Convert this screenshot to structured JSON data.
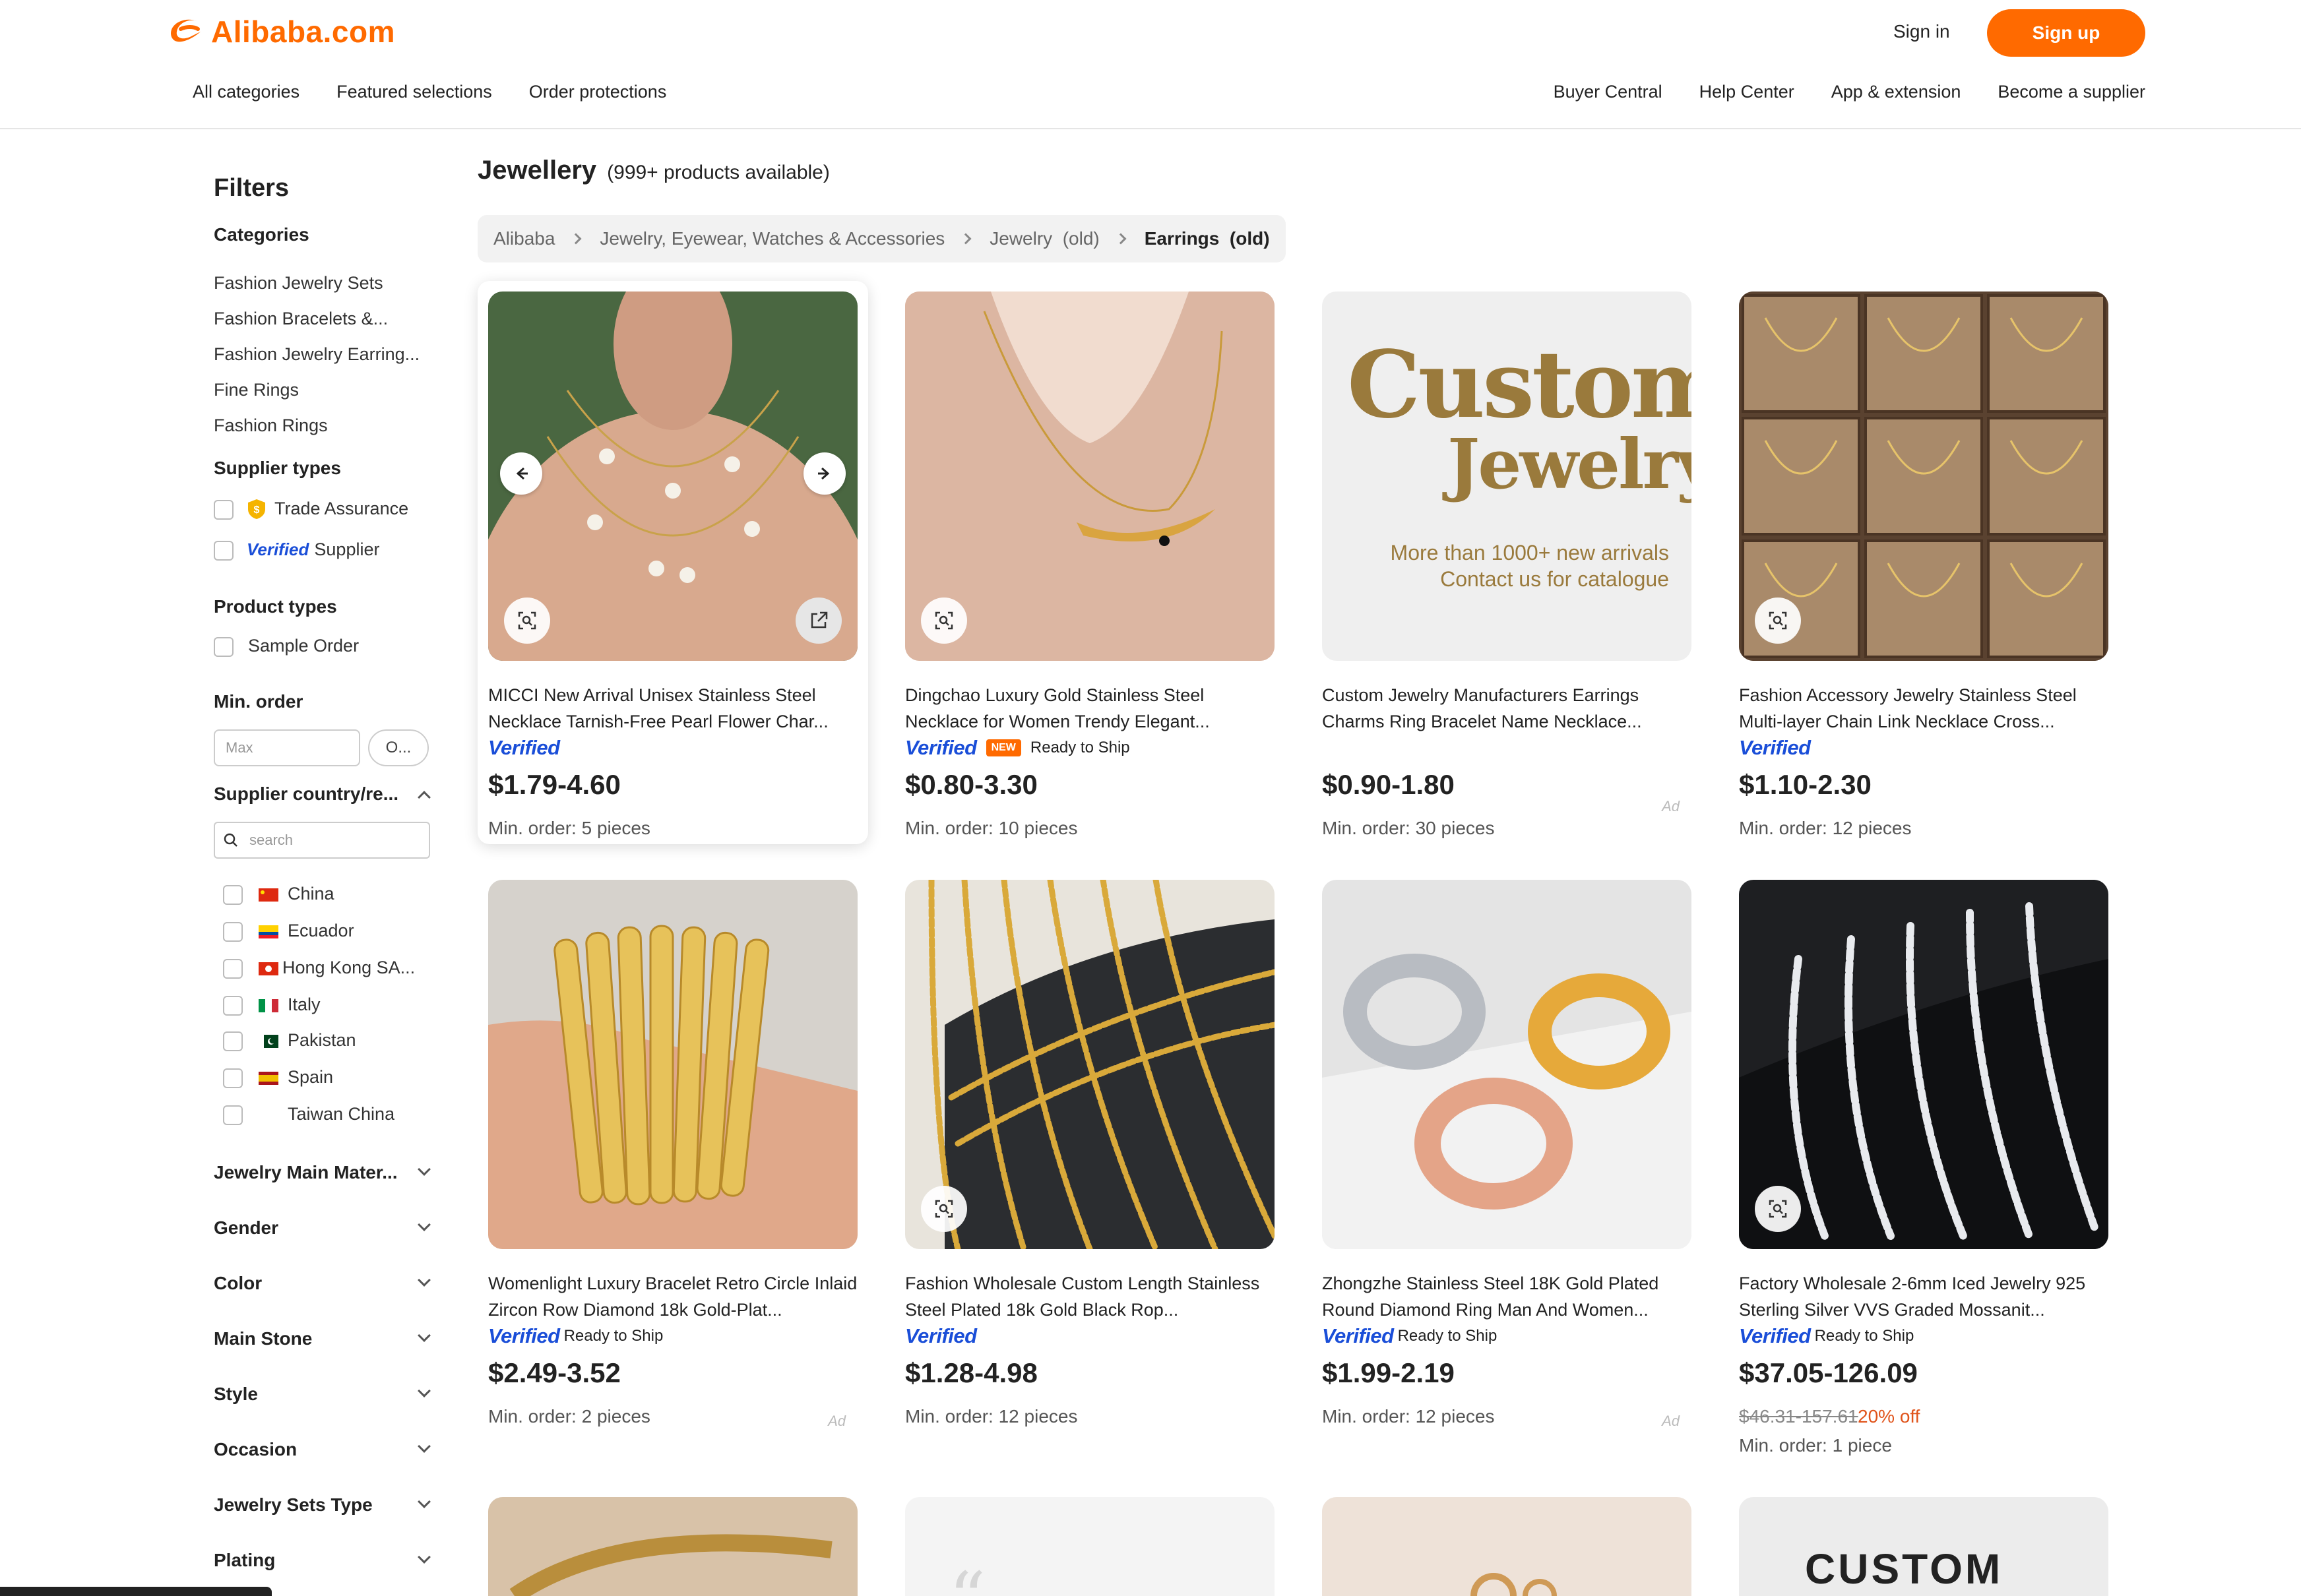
{
  "header": {
    "logo_text": "Alibaba.com",
    "sign_in": "Sign in",
    "sign_up": "Sign up",
    "nav_left": [
      "All categories",
      "Featured selections",
      "Order protections"
    ],
    "nav_right": [
      "Buyer Central",
      "Help Center",
      "App & extension",
      "Become a supplier"
    ]
  },
  "filters": {
    "title": "Filters",
    "categories_label": "Categories",
    "categories": [
      "Fashion Jewelry Sets",
      "Fashion Bracelets &...",
      "Fashion Jewelry Earring...",
      "Fine Rings",
      "Fashion Rings"
    ],
    "supplier_types_label": "Supplier types",
    "trade_assurance": "Trade Assurance",
    "verified_word": "Verified",
    "supplier_word": "Supplier",
    "product_types_label": "Product types",
    "sample_order": "Sample Order",
    "min_order_label": "Min. order",
    "min_placeholder": "Max",
    "ok_label": "O...",
    "country_label": "Supplier country/re...",
    "country_search_placeholder": "search",
    "countries": [
      "China",
      "Ecuador",
      "Hong Kong SA...",
      "Italy",
      "Pakistan",
      "Spain",
      "Taiwan China"
    ],
    "collapsed_sections": [
      "Jewelry Main Mater...",
      "Gender",
      "Color",
      "Main Stone",
      "Style",
      "Occasion",
      "Jewelry Sets Type",
      "Plating"
    ]
  },
  "main": {
    "title": "Jewellery",
    "count": "(999+ products available)",
    "breadcrumb": [
      "Alibaba",
      "Jewelry, Eyewear, Watches & Accessories",
      "Jewelry  (old)",
      "Earrings  (old)"
    ]
  },
  "products": [
    {
      "title": "MICCI New Arrival Unisex Stainless Steel Necklace Tarnish-Free Pearl Flower Char...",
      "verified": "Verified",
      "tag": "",
      "price": "$1.79-4.60",
      "min_order": "Min. order: 5 pieces",
      "ad": ""
    },
    {
      "title": "Dingchao Luxury Gold Stainless Steel Necklace for Women Trendy Elegant...",
      "verified": "Verified",
      "new_badge": "NEW",
      "tag": "Ready to Ship",
      "price": "$0.80-3.30",
      "min_order": "Min. order: 10 pieces",
      "ad": ""
    },
    {
      "title": "Custom Jewelry Manufacturers Earrings Charms Ring Bracelet Name Necklace...",
      "verified": "",
      "tag": "",
      "price": "$0.90-1.80",
      "min_order": "Min. order: 30 pieces",
      "ad": "Ad",
      "image_text": {
        "line1": "Custom",
        "line2": "Jewelry",
        "line3": "More than 1000+ new arrivals",
        "line4": "Contact us for catalogue"
      }
    },
    {
      "title": "Fashion Accessory Jewelry Stainless Steel Multi-layer Chain Link Necklace Cross...",
      "verified": "Verified",
      "tag": "",
      "price": "$1.10-2.30",
      "min_order": "Min. order: 12 pieces",
      "ad": ""
    },
    {
      "title": "Womenlight Luxury Bracelet Retro Circle Inlaid Zircon Row Diamond 18k Gold-Plat...",
      "verified": "Verified",
      "tag": "Ready to Ship",
      "price": "$2.49-3.52",
      "min_order": "Min. order: 2 pieces",
      "ad": "Ad"
    },
    {
      "title": "Fashion Wholesale Custom Length Stainless Steel Plated 18k Gold Black Rop...",
      "verified": "Verified",
      "tag": "",
      "price": "$1.28-4.98",
      "min_order": "Min. order: 12 pieces",
      "ad": ""
    },
    {
      "title": "Zhongzhe Stainless Steel 18K Gold Plated Round Diamond Ring Man And Women...",
      "verified": "Verified",
      "tag": "Ready to Ship",
      "price": "$1.99-2.19",
      "min_order": "Min. order: 12 pieces",
      "ad": "Ad"
    },
    {
      "title": "Factory Wholesale 2-6mm Iced Jewelry 925 Sterling Silver VVS Graded Mossanit...",
      "verified": "Verified",
      "tag": "Ready to Ship",
      "price": "$37.05-126.09",
      "old_price": "$46.31-157.61",
      "discount": "20% off",
      "min_order": "Min. order: 1 piece",
      "ad": ""
    }
  ],
  "bottom_row": {
    "custom_text": "CUSTOM"
  },
  "colors": {
    "brand": "#ff6a00",
    "verified": "#1a4ed8",
    "discount": "#e0531a"
  }
}
